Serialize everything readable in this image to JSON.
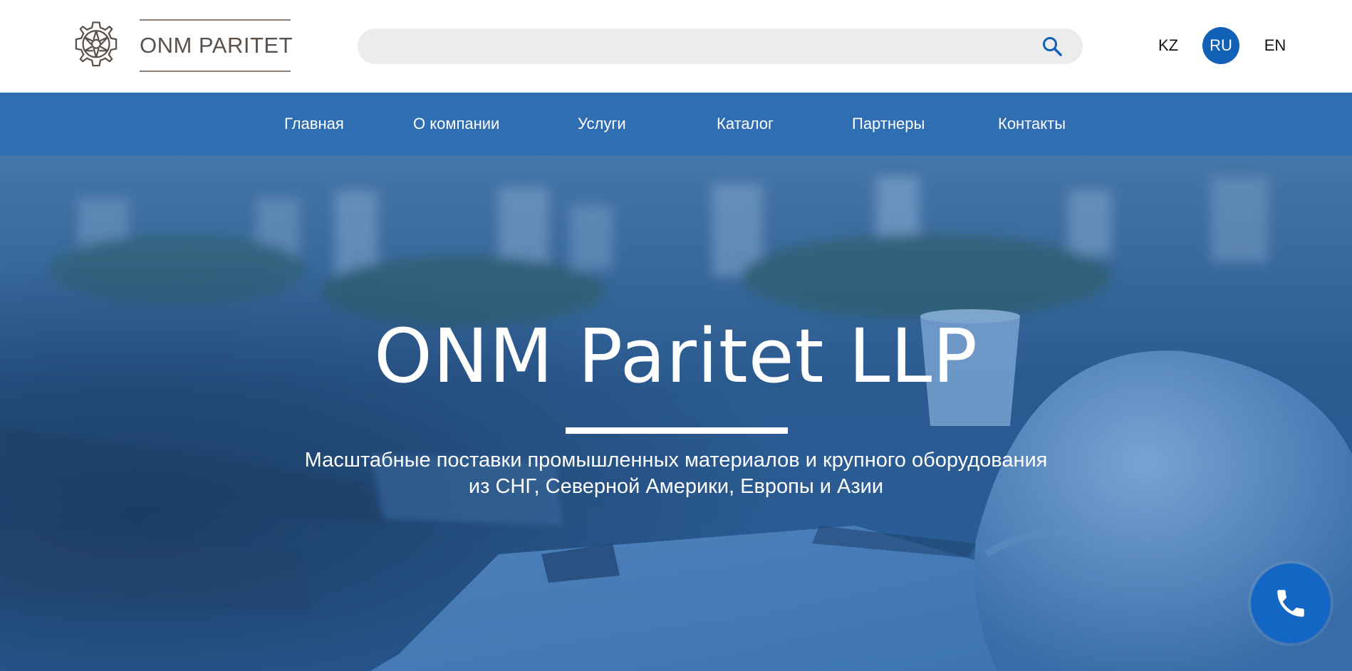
{
  "header": {
    "logo_text": "ONM PARITET",
    "search": {
      "value": "",
      "placeholder": ""
    },
    "languages": [
      {
        "code": "KZ",
        "active": false
      },
      {
        "code": "RU",
        "active": true
      },
      {
        "code": "EN",
        "active": false
      }
    ]
  },
  "nav": {
    "items": [
      {
        "label": "Главная"
      },
      {
        "label": "О компании"
      },
      {
        "label": "Услуги"
      },
      {
        "label": "Каталог"
      },
      {
        "label": "Партнеры"
      },
      {
        "label": "Контакты"
      }
    ]
  },
  "hero": {
    "title": "ONM Paritet LLP",
    "subtitle_line1": "Масштабные поставки промышленных материалов и крупного оборудования",
    "subtitle_line2": "из СНГ, Северной Америки, Европы и Азии"
  },
  "icons": {
    "logo": "gear-icon",
    "search": "search-icon",
    "call": "phone-icon"
  },
  "colors": {
    "nav_background": "#2f6eb2",
    "accent": "#1161b6",
    "call_button": "#1366c3",
    "logo_text": "#5a514b",
    "search_background": "#ececec"
  }
}
